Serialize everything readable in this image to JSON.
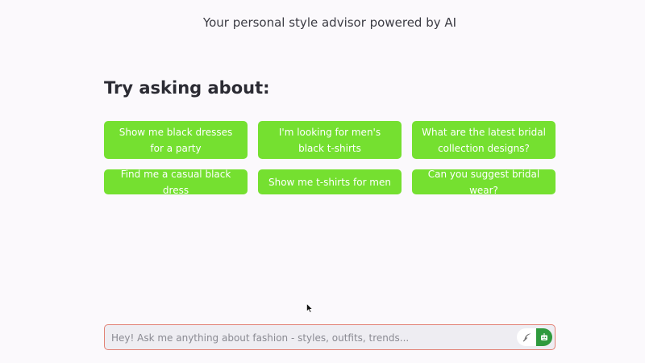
{
  "header": {
    "subtitle": "Your personal style advisor powered by AI"
  },
  "suggestions": {
    "heading": "Try asking about:",
    "items": [
      {
        "label": "Show me black dresses for a party"
      },
      {
        "label": "I'm looking for men's black t-shirts"
      },
      {
        "label": "What are the latest bridal collection designs?"
      },
      {
        "label": "Find me a casual black dress"
      },
      {
        "label": "Show me t-shirts for men"
      },
      {
        "label": "Can you suggest bridal wear?"
      }
    ]
  },
  "chat": {
    "placeholder": "Hey! Ask me anything about fashion - styles, outfits, trends...",
    "value": "",
    "icons": {
      "voice": "feather-icon",
      "send": "robot-icon"
    }
  },
  "colors": {
    "background": "#fbf9fc",
    "suggestion_button": "#75e030",
    "input_border": "#e28276",
    "send_button": "#2f9a3d"
  }
}
